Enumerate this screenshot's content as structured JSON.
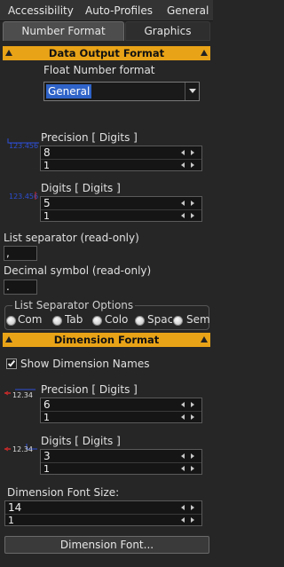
{
  "tabs_top": [
    "Accessibility",
    "Auto-Profiles",
    "General"
  ],
  "tabs_sub": [
    {
      "label": "Number Format",
      "active": true
    },
    {
      "label": "Graphics",
      "active": false
    }
  ],
  "data_output": {
    "header": "Data Output Format",
    "float_label": "Float Number format",
    "float_value": "General",
    "precision": {
      "label": "Precision [ Digits ]",
      "preview": "123.456",
      "value": "8",
      "sub": "1"
    },
    "digits": {
      "label": "Digits [ Digits ]",
      "preview": "123.456",
      "value": "5",
      "sub": "1"
    },
    "list_sep_label": "List separator (read-only)",
    "list_sep_value": ",",
    "decimal_label": "Decimal symbol (read-only)",
    "decimal_value": ".",
    "list_options_title": "List Separator Options",
    "list_options": [
      "Com",
      "Tab",
      "Colo",
      "Spac",
      "Sem"
    ]
  },
  "dimension": {
    "header": "Dimension Format",
    "show_names_label": "Show Dimension Names",
    "show_names_checked": true,
    "precision": {
      "label": "Precision [ Digits ]",
      "preview": "12.34",
      "value": "6",
      "sub": "1"
    },
    "digits": {
      "label": "Digits [ Digits ]",
      "preview": "12.34",
      "value": "3",
      "sub": "1"
    },
    "font_size_label": "Dimension Font Size:",
    "font_size_value": "14",
    "font_size_sub": "1",
    "font_button": "Dimension Font..."
  },
  "colors": {
    "accent": "#e8a317",
    "selection": "#2f63c8",
    "preview_blue": "#2d4fd6",
    "preview_red": "#cc2a2a"
  }
}
